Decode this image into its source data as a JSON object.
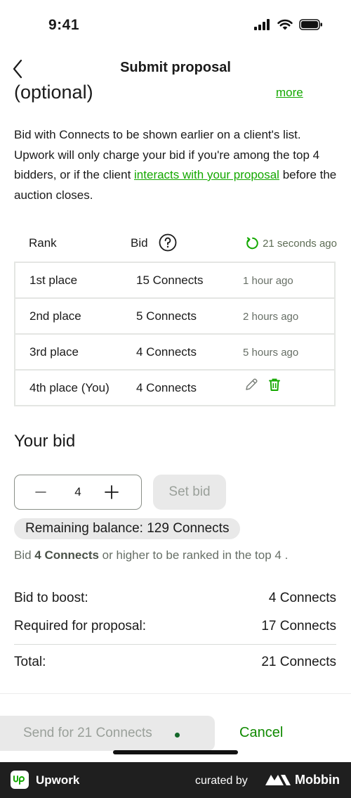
{
  "status_bar": {
    "time": "9:41"
  },
  "nav": {
    "title": "Submit proposal"
  },
  "section": {
    "heading": "(optional)",
    "more_label": "more"
  },
  "description": {
    "part1": "Bid with Connects to be shown earlier on a client's list. Upwork will only charge your bid if you're among the top 4 bidders, or if the client ",
    "link": "interacts with your proposal",
    "part2": " before the auction closes."
  },
  "table": {
    "headers": {
      "rank": "Rank",
      "bid": "Bid"
    },
    "refresh_text": "21 seconds ago",
    "rows": [
      {
        "rank": "1st place",
        "bid": "15 Connects",
        "time": "1 hour ago"
      },
      {
        "rank": "2nd place",
        "bid": "5 Connects",
        "time": "2 hours ago"
      },
      {
        "rank": "3rd place",
        "bid": "4 Connects",
        "time": "5 hours ago"
      },
      {
        "rank": "4th place (You)",
        "bid": "4 Connects",
        "time": ""
      }
    ]
  },
  "your_bid": {
    "heading": "Your bid",
    "value": "4",
    "set_bid_label": "Set bid",
    "balance": "Remaining balance: 129 Connects",
    "hint_pre": "Bid ",
    "hint_amount": "4 Connects",
    "hint_mid": " or higher to be ranked in the top ",
    "hint_top": "4",
    "hint_end": " ."
  },
  "summary": {
    "boost_label": "Bid to boost:",
    "boost_value": "4 Connects",
    "required_label": "Required for proposal:",
    "required_value": "17 Connects",
    "total_label": "Total:",
    "total_value": "21 Connects"
  },
  "actions": {
    "send_label": "Send for 21 Connects",
    "cancel_label": "Cancel"
  },
  "footer": {
    "app_name": "Upwork",
    "curated_by": "curated by",
    "brand": "Mobbin"
  },
  "colors": {
    "accent": "#14a800",
    "muted": "#676f66",
    "disabled_bg": "#e9e9e9",
    "border": "#e4e6e3"
  }
}
